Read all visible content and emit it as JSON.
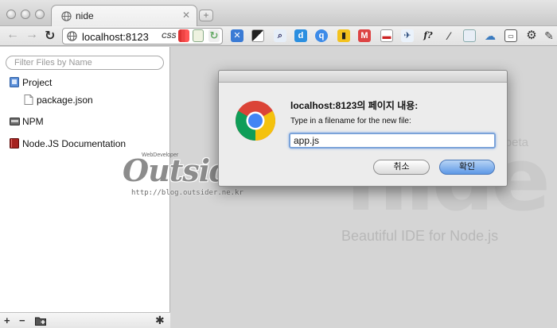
{
  "browser": {
    "tab_title": "nide",
    "url": "localhost:8123",
    "css_badge": "CSS"
  },
  "sidebar": {
    "filter_placeholder": "Filter Files by Name",
    "items": [
      {
        "label": "Project",
        "icon": "folder-blue-icon"
      },
      {
        "label": "package.json",
        "icon": "file-icon"
      },
      {
        "label": "NPM",
        "icon": "npm-icon"
      },
      {
        "label": "Node.JS Documentation",
        "icon": "book-icon"
      }
    ],
    "bottom_buttons": [
      "+",
      "−"
    ]
  },
  "main": {
    "logo_text": "nide",
    "beta_label": "beta",
    "tagline": "Beautiful IDE for Node.js"
  },
  "blog_watermark": {
    "brand": "Outsider",
    "small_text": "WebDeveloper",
    "url": "http://blog.outsider.ne.kr"
  },
  "dialog": {
    "heading": "localhost:8123의 페이지 내용:",
    "message": "Type in a filename for the new file:",
    "input_value": "app.js",
    "cancel_label": "취소",
    "ok_label": "확인"
  },
  "colors": {
    "dialog_ok": "#5d98e6",
    "focus_ring": "#7ba3d9",
    "sidebar_bg": "#ffffff",
    "main_bg": "#d5d5d5"
  }
}
